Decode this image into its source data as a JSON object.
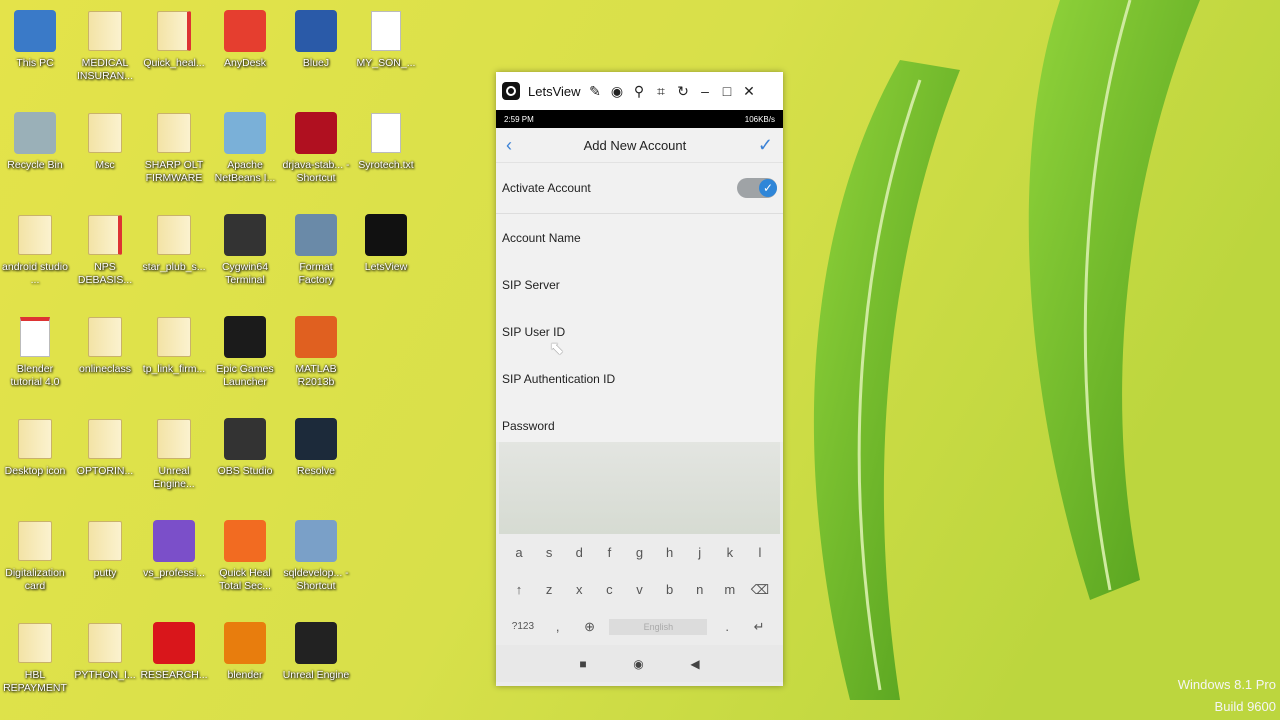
{
  "desktop": {
    "icons": [
      {
        "label": "This PC",
        "icon": "computer-icon"
      },
      {
        "label": "MEDICAL INSURAN...",
        "icon": "folder-icon"
      },
      {
        "label": "Quick_heal...",
        "icon": "pdf-folder-icon"
      },
      {
        "label": "AnyDesk",
        "icon": "anydesk-icon"
      },
      {
        "label": "BlueJ",
        "icon": "bluej-icon"
      },
      {
        "label": "MY_SON_...",
        "icon": "text-file-icon"
      },
      {
        "label": "Recycle Bin",
        "icon": "recycle-bin-icon"
      },
      {
        "label": "Msc",
        "icon": "folder-icon"
      },
      {
        "label": "SHARP OLT FIRMWARE",
        "icon": "folder-icon"
      },
      {
        "label": "Apache NetBeans I...",
        "icon": "netbeans-icon"
      },
      {
        "label": "drjava-stab... - Shortcut",
        "icon": "drjava-icon"
      },
      {
        "label": "Syrotech.txt",
        "icon": "text-file-icon"
      },
      {
        "label": "android studio ...",
        "icon": "folder-icon"
      },
      {
        "label": "NPS DEBASIS...",
        "icon": "pdf-folder-icon"
      },
      {
        "label": "star_plub_s...",
        "icon": "folder-icon"
      },
      {
        "label": "Cygwin64 Terminal",
        "icon": "terminal-icon"
      },
      {
        "label": "Format Factory",
        "icon": "format-factory-icon"
      },
      {
        "label": "LetsView",
        "icon": "letsview-icon"
      },
      {
        "label": "Blender tutorial 4.0",
        "icon": "pdf-icon"
      },
      {
        "label": "onlineclass",
        "icon": "folder-icon"
      },
      {
        "label": "tp_link_firm...",
        "icon": "folder-icon"
      },
      {
        "label": "Epic Games Launcher",
        "icon": "epic-games-icon"
      },
      {
        "label": "MATLAB R2013b",
        "icon": "matlab-icon"
      },
      {
        "label": "Desktop icon",
        "icon": "folder-icon"
      },
      {
        "label": "OPTORIN...",
        "icon": "folder-icon"
      },
      {
        "label": "Unreal Engine...",
        "icon": "folder-icon"
      },
      {
        "label": "OBS Studio",
        "icon": "obs-icon"
      },
      {
        "label": "Resolve",
        "icon": "davinci-resolve-icon"
      },
      {
        "label": "Digitalization card",
        "icon": "folder-icon"
      },
      {
        "label": "putty",
        "icon": "folder-icon"
      },
      {
        "label": "vs_professi...",
        "icon": "visual-studio-icon"
      },
      {
        "label": "Quick Heal Total Sec...",
        "icon": "quick-heal-icon"
      },
      {
        "label": "sqldevelop... - Shortcut",
        "icon": "sql-developer-icon"
      },
      {
        "label": "HBL REPAYMENT",
        "icon": "folder-icon"
      },
      {
        "label": "PYTHON_I...",
        "icon": "folder-icon"
      },
      {
        "label": "RESEARCH...",
        "icon": "opera-icon"
      },
      {
        "label": "blender",
        "icon": "blender-icon"
      },
      {
        "label": "Unreal Engine",
        "icon": "unreal-icon"
      }
    ]
  },
  "letsview": {
    "title": "LetsView",
    "phone": {
      "time": "2:59 PM",
      "status_right": "106KB/s",
      "screen_title": "Add New Account",
      "activate_label": "Activate Account",
      "activate_on": true,
      "fields": [
        "Account Name",
        "SIP Server",
        "SIP User ID",
        "SIP Authentication ID",
        "Password"
      ],
      "keyboard": {
        "row1": [
          "a",
          "s",
          "d",
          "f",
          "g",
          "h",
          "j",
          "k",
          "l"
        ],
        "row2": [
          "z",
          "x",
          "c",
          "v",
          "b",
          "n",
          "m"
        ],
        "numkey": "?123",
        "comma": ",",
        "space": "English",
        "period": "."
      }
    }
  },
  "watermark": {
    "line1": "Windows 8.1 Pro",
    "line2": "Build 9600"
  },
  "colors": {
    "accent": "#2f86d8"
  }
}
